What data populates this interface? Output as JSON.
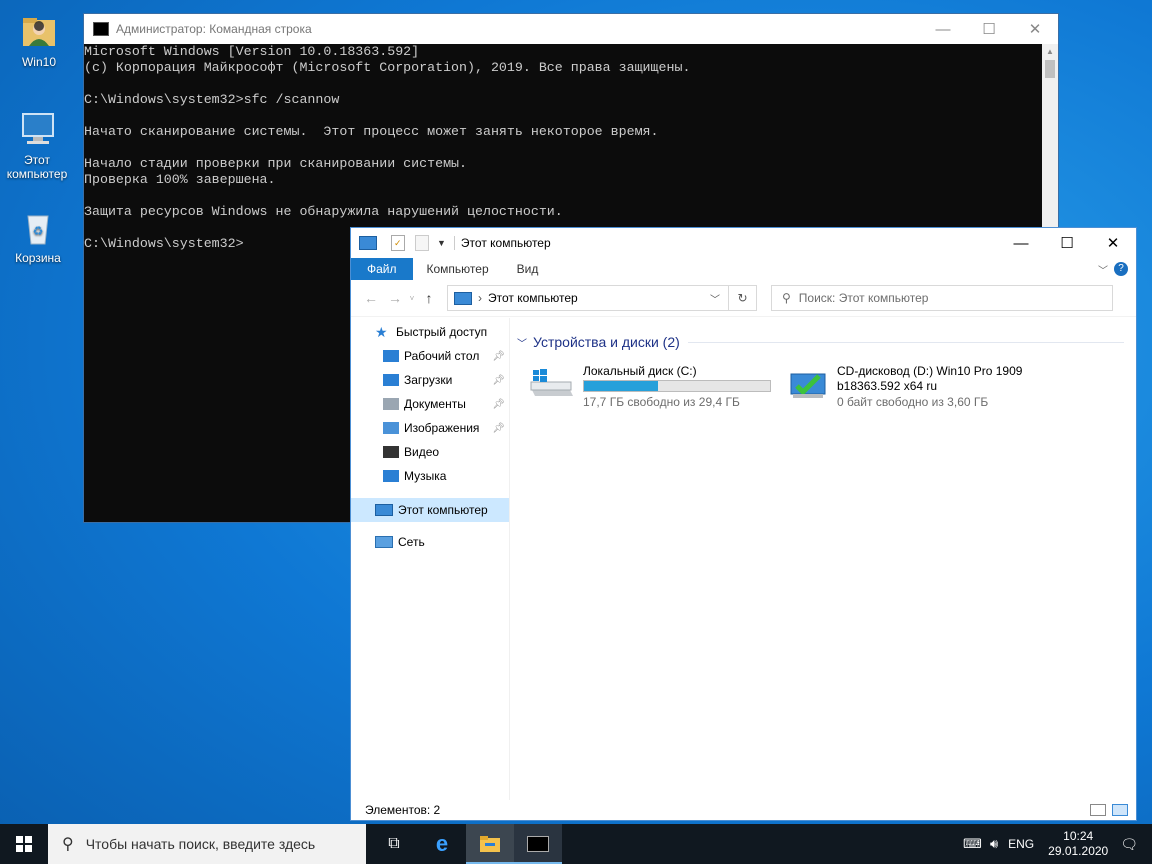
{
  "desktop": {
    "icons": [
      {
        "label": "Win10"
      },
      {
        "label": "Этот компьютер"
      },
      {
        "label": "Корзина"
      }
    ]
  },
  "cmd": {
    "title": "Администратор: Командная строка",
    "lines": [
      "Microsoft Windows [Version 10.0.18363.592]",
      "(c) Корпорация Майкрософт (Microsoft Corporation), 2019. Все права защищены.",
      "",
      "C:\\Windows\\system32>sfc /scannow",
      "",
      "Начато сканирование системы.  Этот процесс может занять некоторое время.",
      "",
      "Начало стадии проверки при сканировании системы.",
      "Проверка 100% завершена.",
      "",
      "Защита ресурсов Windows не обнаружила нарушений целостности.",
      "",
      "C:\\Windows\\system32>"
    ],
    "controls": {
      "minimize": "—",
      "maximize": "☐",
      "close": "✕"
    }
  },
  "explorer": {
    "title": "Этот компьютер",
    "tabs": [
      "Файл",
      "Компьютер",
      "Вид"
    ],
    "address": "Этот компьютер",
    "search_placeholder": "Поиск: Этот компьютер",
    "nav": {
      "quick_access": "Быстрый доступ",
      "quick_items": [
        {
          "label": "Рабочий стол",
          "pinned": true
        },
        {
          "label": "Загрузки",
          "pinned": true
        },
        {
          "label": "Документы",
          "pinned": true
        },
        {
          "label": "Изображения",
          "pinned": true
        },
        {
          "label": "Видео",
          "pinned": false
        },
        {
          "label": "Музыка",
          "pinned": false
        }
      ],
      "this_pc": "Этот компьютер",
      "network": "Сеть"
    },
    "group_header": "Устройства и диски (2)",
    "drives": [
      {
        "name": "Локальный диск (C:)",
        "free_text": "17,7 ГБ свободно из 29,4 ГБ",
        "used_fraction": 0.398
      },
      {
        "name": "CD-дисковод (D:) Win10 Pro 1909",
        "name2": "b18363.592 x64 ru",
        "free_text": "0 байт свободно из 3,60 ГБ"
      }
    ],
    "status": "Элементов: 2"
  },
  "taskbar": {
    "search_placeholder": "Чтобы начать поиск, введите здесь",
    "lang": "ENG",
    "time": "10:24",
    "date": "29.01.2020"
  },
  "colors": {
    "accent": "#1979ca",
    "desktop": "#0f78d4",
    "taskbar": "#101820"
  }
}
